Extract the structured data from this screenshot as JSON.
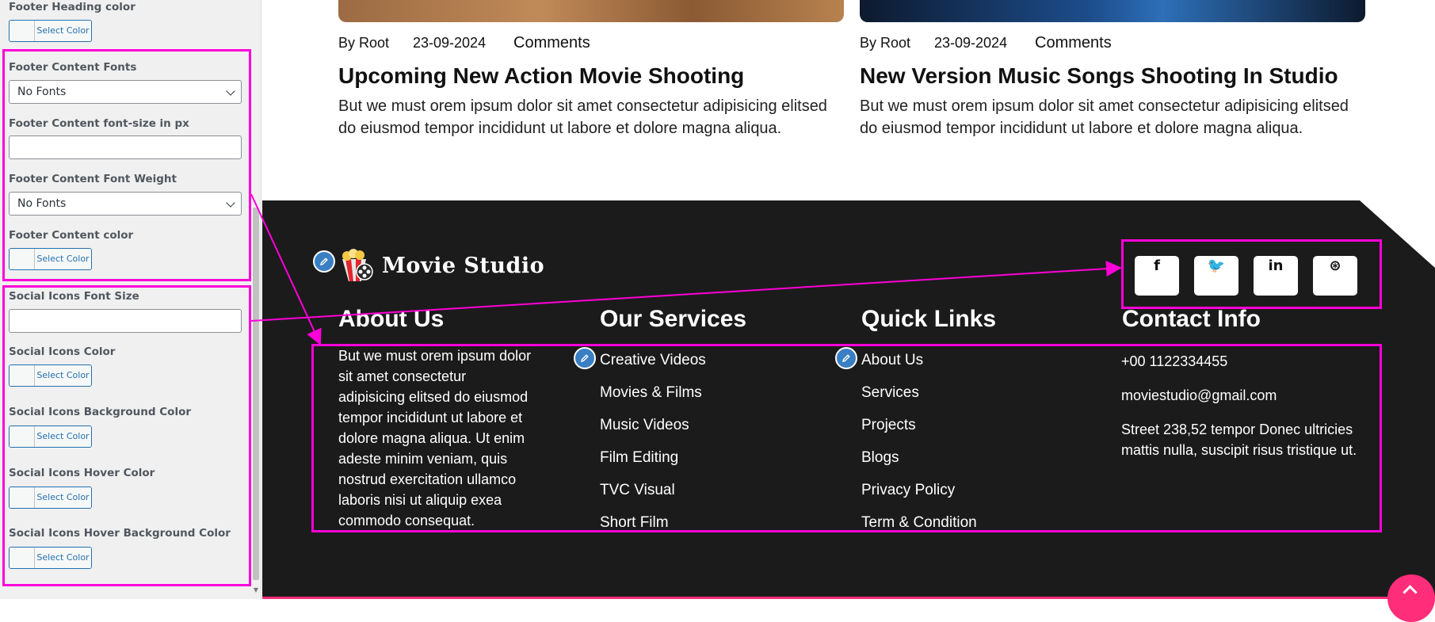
{
  "panel": {
    "footer_heading_color": {
      "label": "Footer Heading color",
      "button": "Select Color"
    },
    "footer_content_fonts": {
      "label": "Footer Content Fonts",
      "value": "No Fonts"
    },
    "footer_content_font_size": {
      "label": "Footer Content font-size in px",
      "value": ""
    },
    "footer_content_font_weight": {
      "label": "Footer Content Font Weight",
      "value": "No Fonts"
    },
    "footer_content_color": {
      "label": "Footer Content color",
      "button": "Select Color"
    },
    "social_icons_font_size": {
      "label": "Social Icons Font Size",
      "value": ""
    },
    "social_icons_color": {
      "label": "Social Icons Color",
      "button": "Select Color"
    },
    "social_icons_bg_color": {
      "label": "Social Icons Background Color",
      "button": "Select Color"
    },
    "social_icons_hover_color": {
      "label": "Social Icons Hover Color",
      "button": "Select Color"
    },
    "social_icons_hover_bg_color": {
      "label": "Social Icons Hover Background Color",
      "button": "Select Color"
    }
  },
  "posts": [
    {
      "author": "By Root",
      "date": "23-09-2024",
      "comments": "Comments",
      "title": "Upcoming New Action Movie Shooting",
      "excerpt": "But we must orem ipsum dolor sit amet consectetur adipisicing elitsed do eiusmod tempor incididunt ut labore et dolore magna aliqua."
    },
    {
      "author": "By Root",
      "date": "23-09-2024",
      "comments": "Comments",
      "title": "New Version Music Songs Shooting In Studio",
      "excerpt": "But we must orem ipsum dolor sit amet consectetur adipisicing elitsed do eiusmod tempor incididunt ut labore et dolore magna aliqua."
    }
  ],
  "footer": {
    "brand": "Movie Studio",
    "social": [
      {
        "icon": "facebook-icon",
        "glyph": "f"
      },
      {
        "icon": "twitter-icon",
        "glyph": "🐦"
      },
      {
        "icon": "linkedin-icon",
        "glyph": "in"
      },
      {
        "icon": "dribbble-icon",
        "glyph": "⊛"
      }
    ],
    "about": {
      "heading": "About Us",
      "text": "But we must orem ipsum dolor sit amet consectetur adipisicing elitsed do eiusmod tempor incididunt ut labore et dolore magna aliqua. Ut enim adeste minim veniam, quis nostrud exercitation ullamco laboris nisi ut aliquip exea commodo consequat."
    },
    "services": {
      "heading": "Our Services",
      "items": [
        "Creative Videos",
        "Movies & Films",
        "Music Videos",
        "Film Editing",
        "TVC Visual",
        "Short Film"
      ]
    },
    "quick_links": {
      "heading": "Quick Links",
      "items": [
        "About Us",
        "Services",
        "Projects",
        "Blogs",
        "Privacy Policy",
        "Term & Condition"
      ]
    },
    "contact": {
      "heading": "Contact Info",
      "phone": "+00 1122334455",
      "email": "moviestudio@gmail.com",
      "address": "Street 238,52 tempor Donec ultricies mattis nulla, suscipit risus tristique ut."
    }
  },
  "colors": {
    "highlight": "#ff00d8",
    "footer_bg": "#1c1b1c",
    "accent": "#ff2d7a",
    "wp_blue": "#2271b1"
  }
}
